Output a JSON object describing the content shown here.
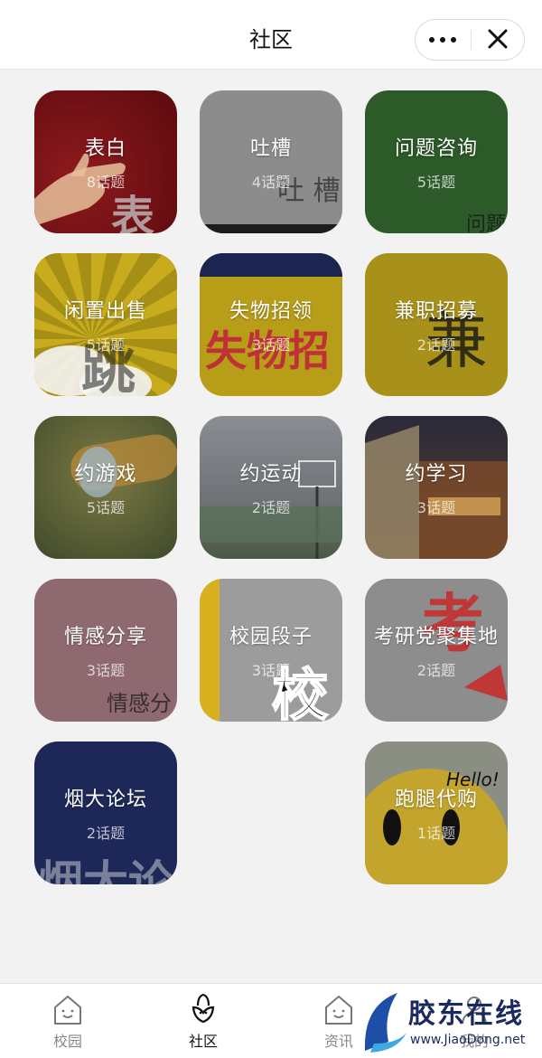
{
  "header": {
    "title": "社区"
  },
  "tiles": [
    {
      "title": "表白",
      "count": "8话题",
      "bg": "#7a0f14",
      "deco": "表"
    },
    {
      "title": "吐槽",
      "count": "4话题",
      "bg": "#8a8a8a",
      "deco": "吐 槽"
    },
    {
      "title": "问题咨询",
      "count": "5话题",
      "bg": "#2f5d2a",
      "deco": "问题"
    },
    {
      "title": "闲置出售",
      "count": "5话题",
      "bg": "#b9a11a",
      "deco": "跳"
    },
    {
      "title": "失物招领",
      "count": "3话题",
      "bg": "#b59c1a",
      "deco": "失物招"
    },
    {
      "title": "兼职招募",
      "count": "2话题",
      "bg": "#a58f12",
      "deco": "兼"
    },
    {
      "title": "约游戏",
      "count": "5话题",
      "bg": "#6b6a3a"
    },
    {
      "title": "约运动",
      "count": "2话题",
      "bg": "#7a7e80"
    },
    {
      "title": "约学习",
      "count": "3话题",
      "bg": "#5a3a2a"
    },
    {
      "title": "情感分享",
      "count": "3话题",
      "bg": "#8f6b70",
      "deco": "情感分"
    },
    {
      "title": "校园段子",
      "count": "3话题",
      "bg": "#9a9a9a",
      "deco": "校"
    },
    {
      "title": "考研党聚集地",
      "count": "2话题",
      "bg": "#8e8e8e",
      "deco": "考"
    },
    {
      "title": "烟大论坛",
      "count": "2话题",
      "bg": "#1e2a5a",
      "deco": "烟大论"
    },
    {
      "title": "跑腿代购",
      "count": "1话题",
      "bg": "#8b8d7e",
      "deco": "Hello!"
    }
  ],
  "tabs": [
    {
      "label": "校园",
      "icon": "house-smile-icon"
    },
    {
      "label": "社区",
      "icon": "sprout-icon"
    },
    {
      "label": "资讯",
      "icon": "house-smile-icon"
    },
    {
      "label": "我的",
      "icon": "user-icon"
    }
  ],
  "watermark": {
    "text": "胶东在线",
    "url": "www.JiaoDong.net"
  },
  "colors": {
    "header_bg": "#ffffff",
    "page_bg": "#f2f2f2",
    "tab_active": "#111111",
    "tab_inactive": "#888888"
  }
}
